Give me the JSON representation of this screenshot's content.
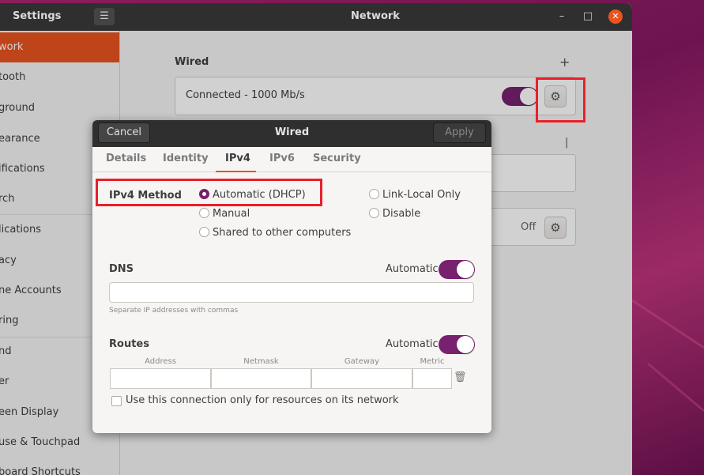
{
  "settings_window": {
    "app_title": "Settings",
    "window_title": "Network",
    "menu_icon": "hamburger-icon",
    "controls": {
      "minimize": "–",
      "maximize": "□",
      "close": "✕"
    }
  },
  "sidebar": {
    "items": [
      {
        "label": "work",
        "active": true
      },
      {
        "label": "tooth"
      },
      {
        "label": "ground"
      },
      {
        "label": "earance"
      },
      {
        "label": "ifications"
      },
      {
        "label": "rch"
      },
      {
        "label": "lications"
      },
      {
        "label": "acy"
      },
      {
        "label": "ne Accounts"
      },
      {
        "label": "ring"
      },
      {
        "label": "nd"
      },
      {
        "label": "er"
      },
      {
        "label": "een Display"
      },
      {
        "label": "use & Touchpad"
      },
      {
        "label": "board Shortcuts"
      }
    ]
  },
  "network_panel": {
    "wired_section_title": "Wired",
    "add_button": "+",
    "wired_connection": "Connected - 1000 Mb/s",
    "vpn_add_button": "|",
    "proxy_status": "Off",
    "accent_color": "#77216f",
    "highlight_color": "#e8202a"
  },
  "dialog": {
    "title": "Wired",
    "cancel_label": "Cancel",
    "apply_label": "Apply",
    "tabs": [
      {
        "label": "Details"
      },
      {
        "label": "Identity"
      },
      {
        "label": "IPv4",
        "active": true
      },
      {
        "label": "IPv6"
      },
      {
        "label": "Security"
      }
    ],
    "ipv4": {
      "method_label": "IPv4 Method",
      "options": [
        {
          "label": "Automatic (DHCP)",
          "checked": true
        },
        {
          "label": "Manual"
        },
        {
          "label": "Shared to other computers"
        },
        {
          "label": "Link-Local Only"
        },
        {
          "label": "Disable"
        }
      ],
      "dns_label": "DNS",
      "dns_automatic_label": "Automatic",
      "dns_value": "",
      "dns_hint": "Separate IP addresses with commas",
      "routes_label": "Routes",
      "routes_automatic_label": "Automatic",
      "route_columns": [
        "Address",
        "Netmask",
        "Gateway",
        "Metric"
      ],
      "only_resources_label": "Use this connection only for resources on its network"
    }
  }
}
